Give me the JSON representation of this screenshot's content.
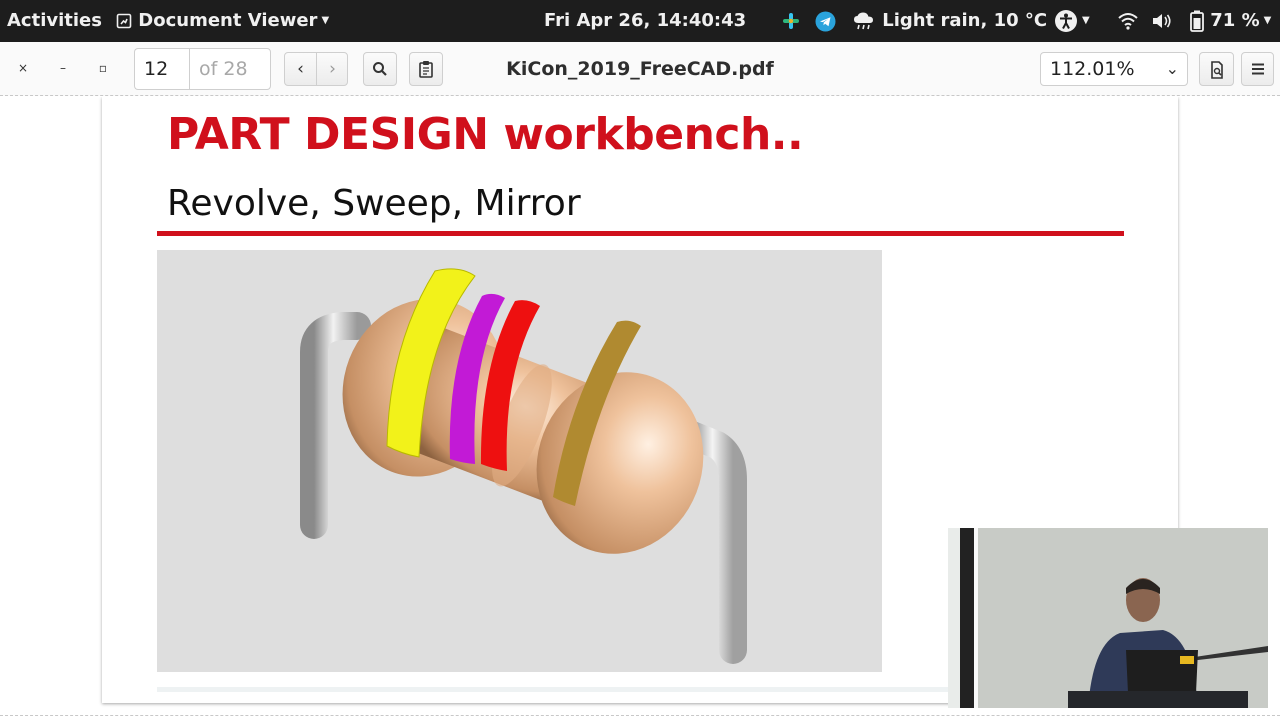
{
  "topbar": {
    "activities": "Activities",
    "app_name": "Document Viewer",
    "clock": "Fri Apr 26, 14:40:43",
    "weather": "Light rain, 10 °C",
    "battery": "71 %"
  },
  "headerbar": {
    "page_current": "12",
    "page_total": "of 28",
    "title": "KiCon_2019_FreeCAD.pdf",
    "zoom": "112.01%"
  },
  "slide": {
    "title": "PART DESIGN workbench..",
    "subtitle": "Revolve, Sweep, Mirror"
  },
  "colors": {
    "title_red": "#d0101c",
    "resistor_body": "#e6b48a",
    "band_1": "#f2f21a",
    "band_2": "#c21ad6",
    "band_3": "#ee1010",
    "band_4": "#b08a30"
  }
}
